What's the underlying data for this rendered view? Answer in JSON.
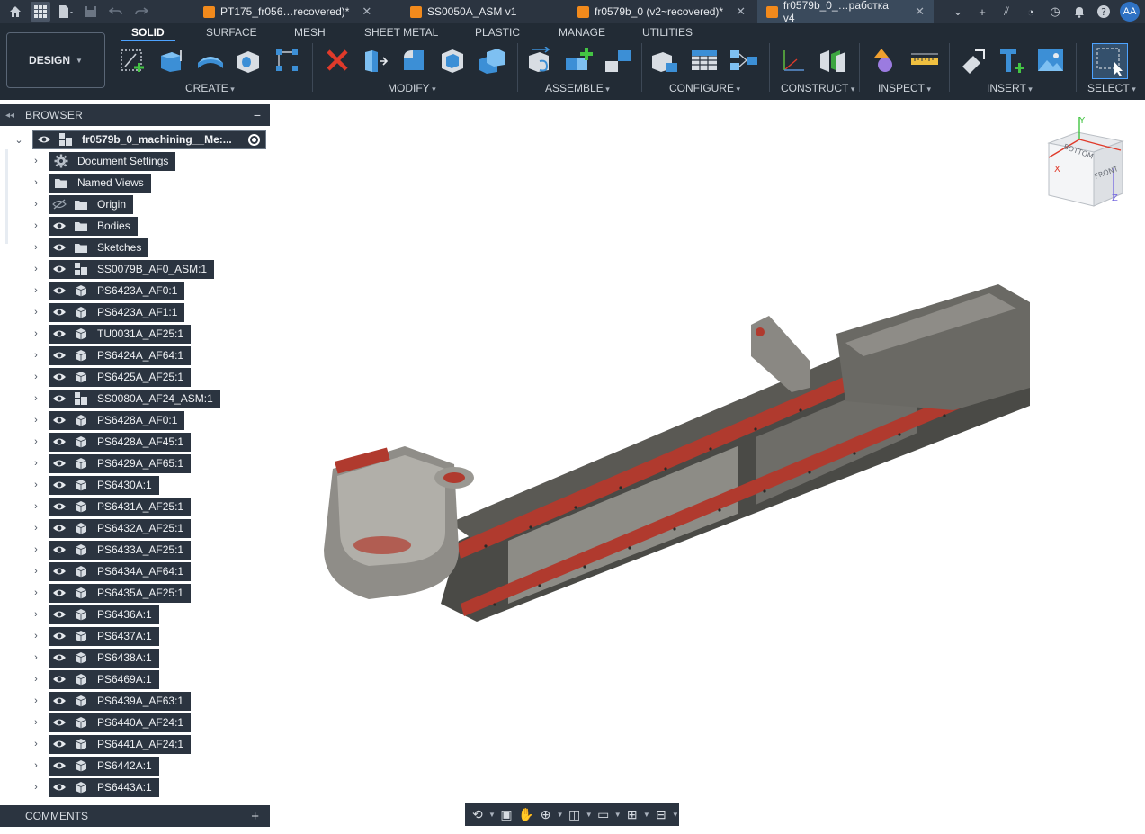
{
  "tabs": [
    {
      "label": "PT175_fr056…recovered)*",
      "active": false,
      "closable": true
    },
    {
      "label": "SS0050A_ASM v1",
      "active": false,
      "closable": false
    },
    {
      "label": "fr0579b_0 (v2~recovered)*",
      "active": false,
      "closable": true
    },
    {
      "label": "fr0579b_0_…работка v4",
      "active": true,
      "closable": true
    }
  ],
  "user": {
    "initials": "AA"
  },
  "toolbar": {
    "workspace_button": "DESIGN",
    "tabs": [
      "SOLID",
      "SURFACE",
      "MESH",
      "SHEET METAL",
      "PLASTIC",
      "MANAGE",
      "UTILITIES"
    ],
    "active_tab": "SOLID",
    "groups": [
      "CREATE",
      "MODIFY",
      "ASSEMBLE",
      "CONFIGURE",
      "CONSTRUCT",
      "INSPECT",
      "INSERT",
      "SELECT"
    ]
  },
  "browser": {
    "title": "BROWSER",
    "root": {
      "label": "fr0579b_0_machining__Me:..."
    },
    "items": [
      {
        "label": "Document Settings",
        "icon": "gear-icon",
        "eye": "none"
      },
      {
        "label": "Named Views",
        "icon": "folder-icon",
        "eye": "none"
      },
      {
        "label": "Origin",
        "icon": "folder-icon",
        "eye": "hidden"
      },
      {
        "label": "Bodies",
        "icon": "folder-icon",
        "eye": "visible"
      },
      {
        "label": "Sketches",
        "icon": "folder-icon",
        "eye": "visible"
      },
      {
        "label": "SS0079B_AF0_ASM:1",
        "icon": "assembly-icon",
        "eye": "visible"
      },
      {
        "label": "PS6423A_AF0:1",
        "icon": "component-icon",
        "eye": "visible"
      },
      {
        "label": "PS6423A_AF1:1",
        "icon": "component-icon",
        "eye": "visible"
      },
      {
        "label": "TU0031A_AF25:1",
        "icon": "component-icon",
        "eye": "visible"
      },
      {
        "label": "PS6424A_AF64:1",
        "icon": "component-icon",
        "eye": "visible"
      },
      {
        "label": "PS6425A_AF25:1",
        "icon": "component-icon",
        "eye": "visible"
      },
      {
        "label": "SS0080A_AF24_ASM:1",
        "icon": "assembly-icon",
        "eye": "visible"
      },
      {
        "label": "PS6428A_AF0:1",
        "icon": "component-icon",
        "eye": "visible"
      },
      {
        "label": "PS6428A_AF45:1",
        "icon": "component-icon",
        "eye": "visible"
      },
      {
        "label": "PS6429A_AF65:1",
        "icon": "component-icon",
        "eye": "visible"
      },
      {
        "label": "PS6430A:1",
        "icon": "component-icon",
        "eye": "visible"
      },
      {
        "label": "PS6431A_AF25:1",
        "icon": "component-icon",
        "eye": "visible"
      },
      {
        "label": "PS6432A_AF25:1",
        "icon": "component-icon",
        "eye": "visible"
      },
      {
        "label": "PS6433A_AF25:1",
        "icon": "component-icon",
        "eye": "visible"
      },
      {
        "label": "PS6434A_AF64:1",
        "icon": "component-icon",
        "eye": "visible"
      },
      {
        "label": "PS6435A_AF25:1",
        "icon": "component-icon",
        "eye": "visible"
      },
      {
        "label": "PS6436A:1",
        "icon": "component-icon",
        "eye": "visible"
      },
      {
        "label": "PS6437A:1",
        "icon": "component-icon",
        "eye": "visible"
      },
      {
        "label": "PS6438A:1",
        "icon": "component-icon",
        "eye": "visible"
      },
      {
        "label": "PS6469A:1",
        "icon": "component-icon",
        "eye": "visible"
      },
      {
        "label": "PS6439A_AF63:1",
        "icon": "component-icon",
        "eye": "visible"
      },
      {
        "label": "PS6440A_AF24:1",
        "icon": "component-icon",
        "eye": "visible"
      },
      {
        "label": "PS6441A_AF24:1",
        "icon": "component-icon",
        "eye": "visible"
      },
      {
        "label": "PS6442A:1",
        "icon": "component-icon",
        "eye": "visible"
      },
      {
        "label": "PS6443A:1",
        "icon": "component-icon",
        "eye": "visible"
      }
    ]
  },
  "viewcube": {
    "faces": [
      "BOTTOM",
      "FRONT"
    ],
    "axes": [
      "Y",
      "X",
      "Z"
    ]
  },
  "comments": {
    "title": "COMMENTS"
  },
  "colors": {
    "panel": "#2b3440",
    "toolbar": "#222b35",
    "accent": "#4da3ff",
    "doc_icon": "#f28a1c",
    "model_red": "#b03a2e"
  }
}
